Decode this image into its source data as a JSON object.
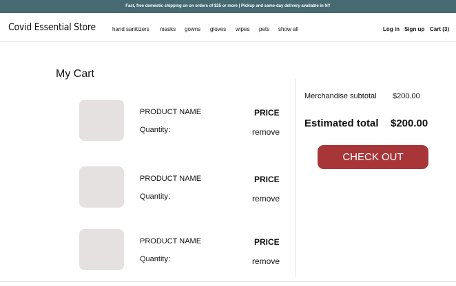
{
  "banner": {
    "text": "Fast, free domestic shipping on on orders of $25 or more | Pickup and same-day delivery available in NY"
  },
  "header": {
    "brand": "Covid Essential Store",
    "nav": [
      {
        "label": "hand sanitizers"
      },
      {
        "label": "masks"
      },
      {
        "label": "gowns"
      },
      {
        "label": "gloves"
      },
      {
        "label": "wipes"
      },
      {
        "label": "pets"
      },
      {
        "label": "show all"
      }
    ],
    "login": "Log in",
    "signup": "Sign up",
    "cart": "Cart (3)"
  },
  "cart": {
    "title": "My Cart",
    "items": [
      {
        "name": "PRODUCT NAME",
        "quantity_label": "Quantity:",
        "price": "PRICE",
        "remove": "remove"
      },
      {
        "name": "PRODUCT NAME",
        "quantity_label": "Quantity:",
        "price": "PRICE",
        "remove": "remove"
      },
      {
        "name": "PRODUCT NAME",
        "quantity_label": "Quantity:",
        "price": "PRICE",
        "remove": "remove"
      }
    ]
  },
  "summary": {
    "subtotal_label": "Merchandise subtotal",
    "subtotal_value": "$200.00",
    "total_label": "Estimated total",
    "total_value": "$200.00",
    "checkout": "CHECK OUT"
  },
  "colors": {
    "banner_bg": "#476a72",
    "checkout_bg": "#a83638",
    "thumbnail_bg": "#e5e1e0"
  }
}
